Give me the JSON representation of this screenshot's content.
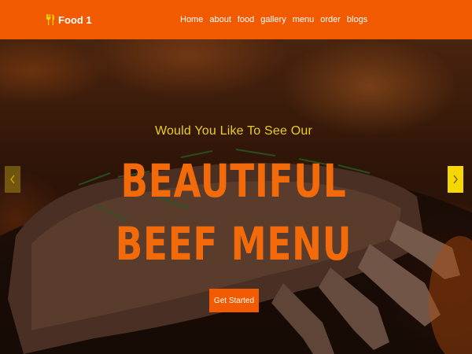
{
  "brand": {
    "name": "Food 1",
    "icon": "fork-knife-icon"
  },
  "nav": {
    "items": [
      {
        "label": "Home"
      },
      {
        "label": "about"
      },
      {
        "label": "food"
      },
      {
        "label": "gallery"
      },
      {
        "label": "menu"
      },
      {
        "label": "order"
      },
      {
        "label": "blogs"
      }
    ]
  },
  "hero": {
    "subtitle": "Would You Like To See Our",
    "title_line1": "BEAUTIFUL",
    "title_line2": "BEEF MENU",
    "cta_label": "Get Started",
    "prev_icon": "chevron-left-icon",
    "next_icon": "chevron-right-icon"
  },
  "colors": {
    "nav_bg": "#f25a00",
    "title": "#f26a0a",
    "subtitle": "#e8cf1a",
    "arrow_active": "#f5d800"
  }
}
